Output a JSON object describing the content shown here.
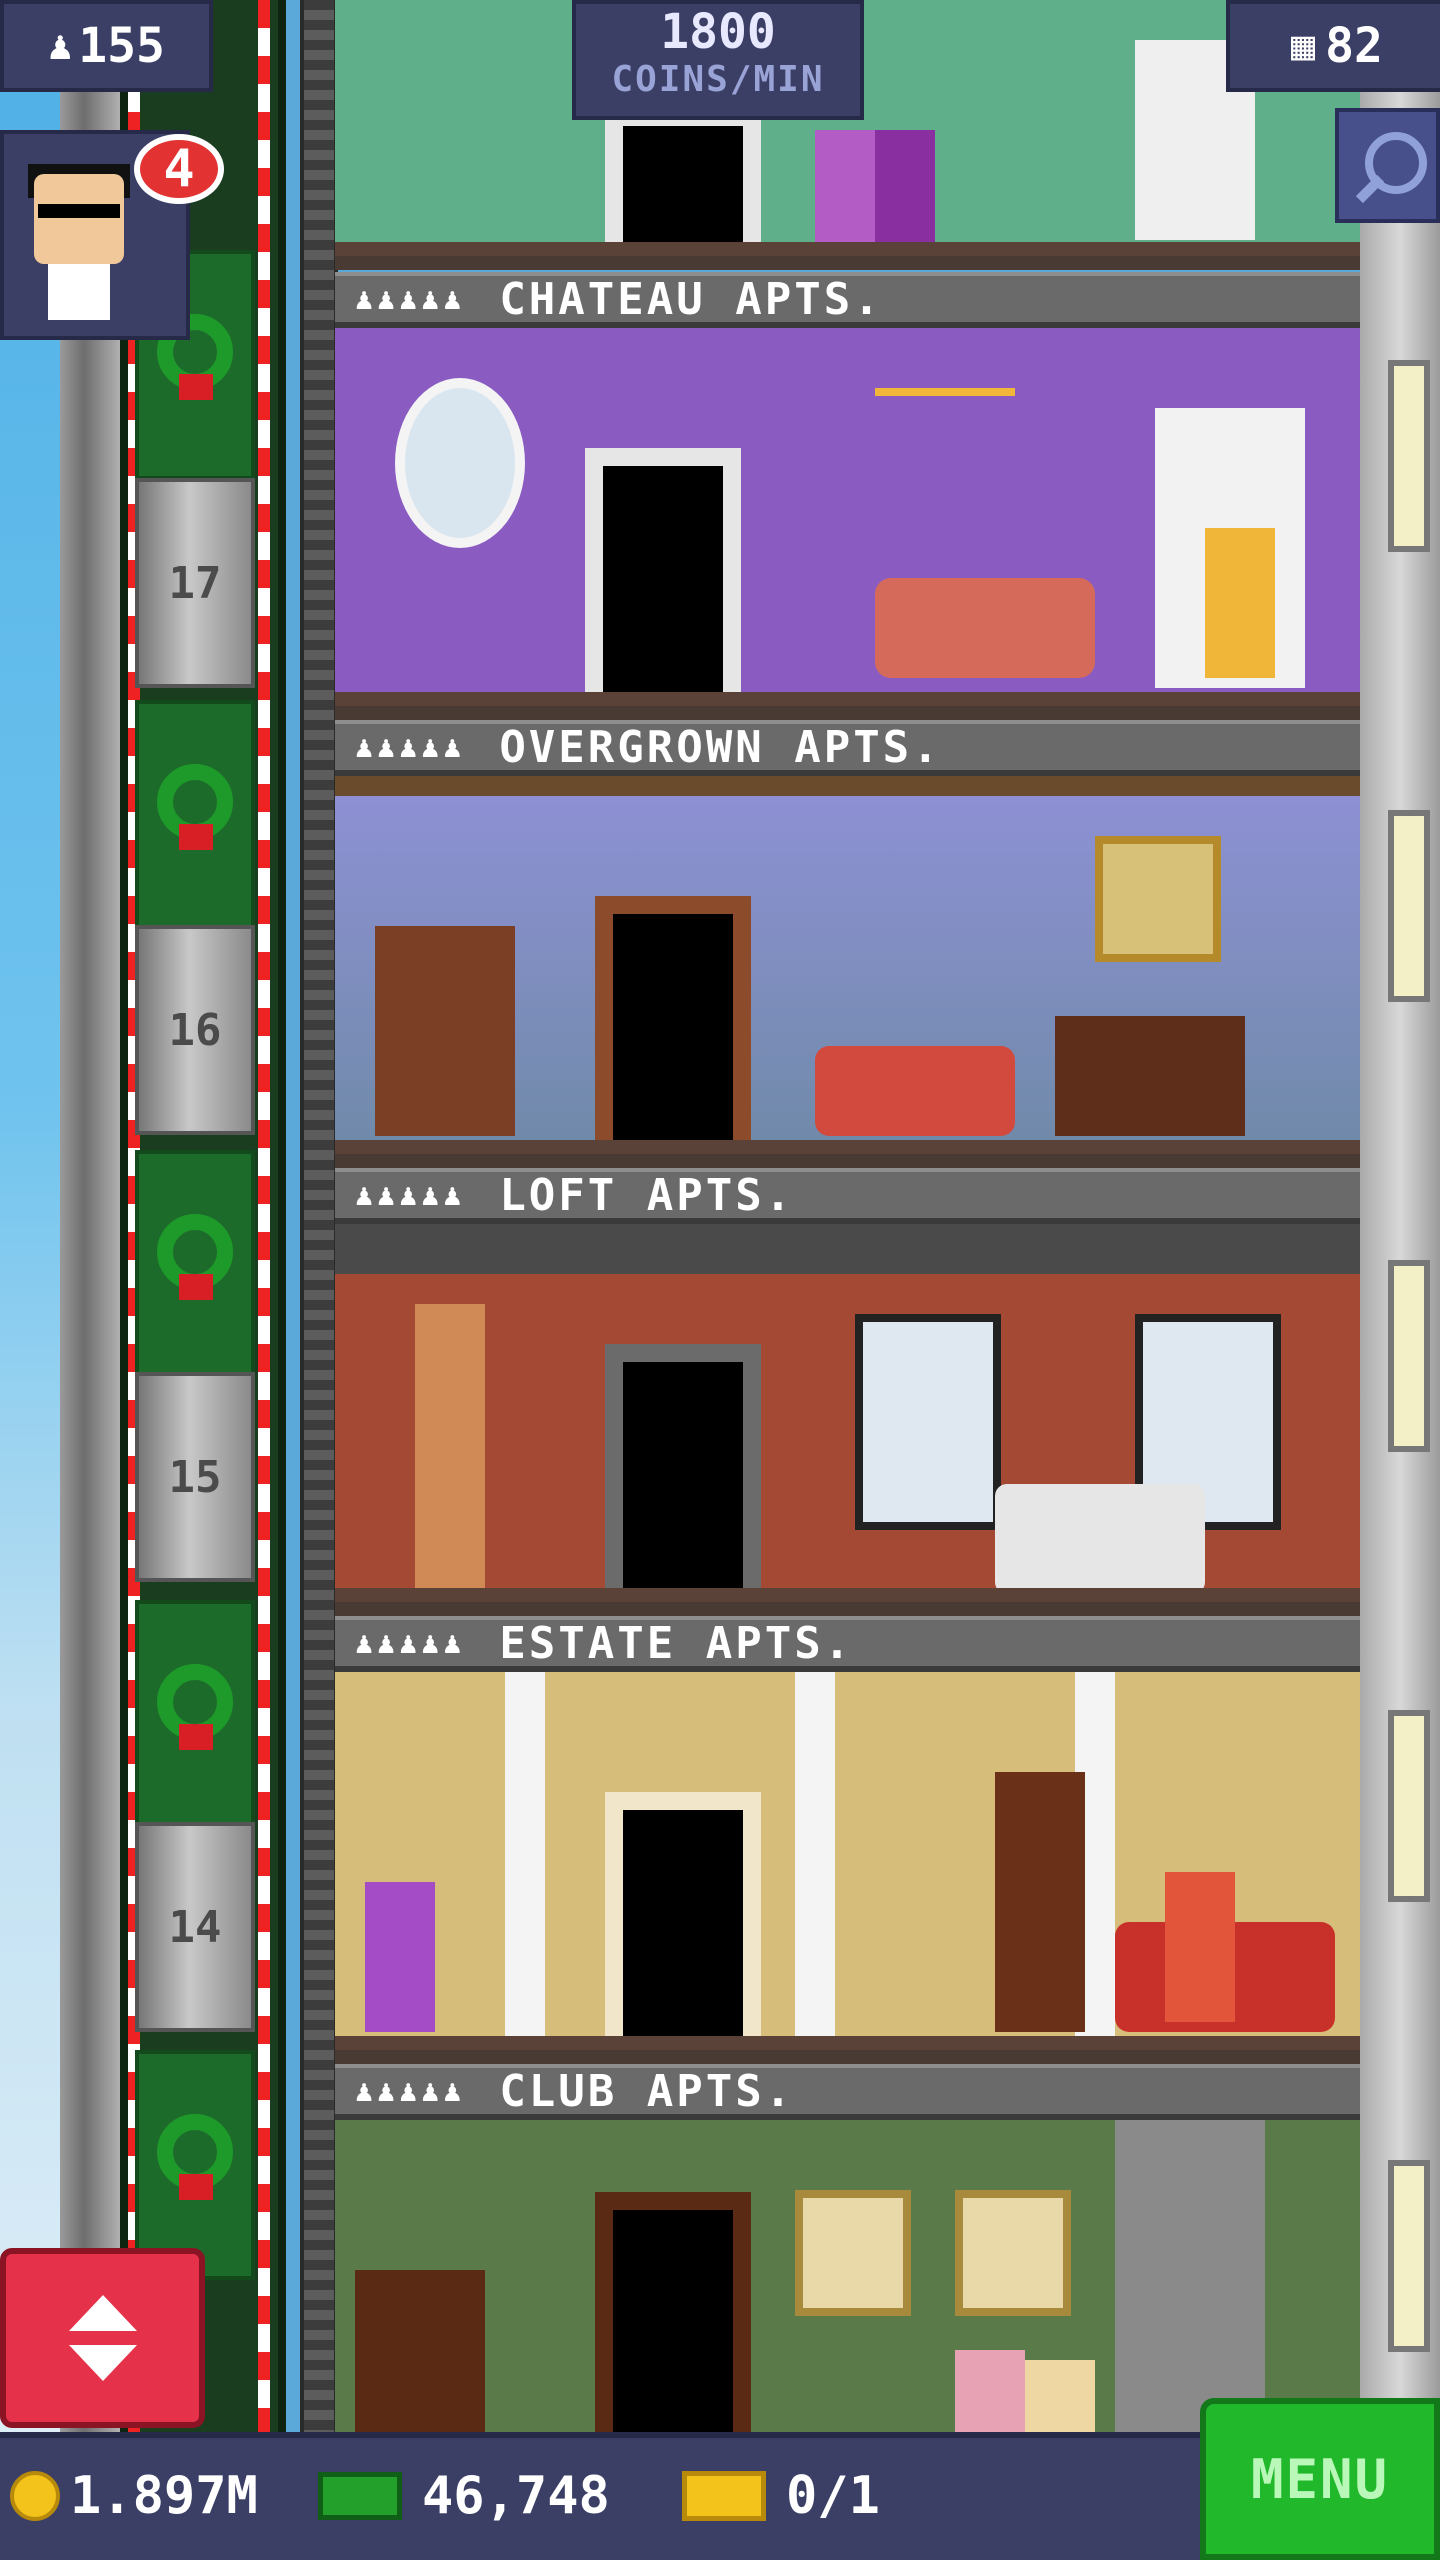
{
  "hud": {
    "population": "155",
    "coins_rate_value": "1800",
    "coins_rate_unit": "COINS/MIN",
    "floors_count": "82",
    "vip_count": "4"
  },
  "elevator": {
    "floor_labels": [
      "17",
      "16",
      "15",
      "14"
    ]
  },
  "floors": [
    {
      "name": "CHATEAU APTS.",
      "stars": "♟♟♟♟♟"
    },
    {
      "name": "OVERGROWN APTS.",
      "stars": "♟♟♟♟♟"
    },
    {
      "name": "LOFT APTS.",
      "stars": "♟♟♟♟♟"
    },
    {
      "name": "ESTATE APTS.",
      "stars": "♟♟♟♟♟"
    },
    {
      "name": "CLUB APTS.",
      "stars": "♟♟♟♟♟"
    }
  ],
  "bottom_bar": {
    "coins": "1.897M",
    "bux": "46,748",
    "tickets": "0/1",
    "menu_label": "MENU"
  },
  "colors": {
    "hud_bg": "#3b3f66",
    "menu_green": "#22b82c",
    "lift_red": "#e6314a"
  }
}
